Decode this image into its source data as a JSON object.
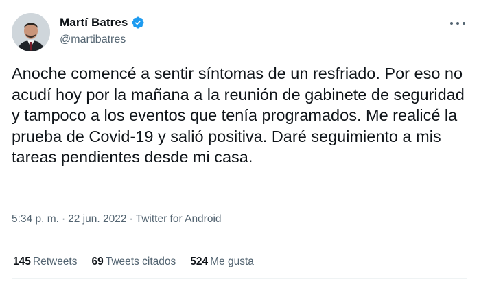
{
  "author": {
    "name": "Martí Batres",
    "handle": "@martibatres",
    "verified": true,
    "verified_color": "#1d9bf0"
  },
  "icons": {
    "more": "more-horizontal-icon",
    "verified": "verified-badge-icon"
  },
  "tweet": {
    "text": "Anoche comencé a sentir síntomas de un resfriado. Por eso no acudí hoy por la mañana a la reunión de gabinete de seguridad y tampoco a los eventos que tenía programados. Me realicé la prueba de Covid-19 y salió positiva. Daré seguimiento a mis tareas pendientes desde mi casa.",
    "time": "5:34 p. m.",
    "date": "22 jun. 2022",
    "source": "Twitter for Android",
    "separator": "·"
  },
  "stats": {
    "retweets": {
      "count": "145",
      "label": "Retweets"
    },
    "quotes": {
      "count": "69",
      "label": "Tweets citados"
    },
    "likes": {
      "count": "524",
      "label": "Me gusta"
    }
  },
  "colors": {
    "text": "#0f1419",
    "secondary": "#536471",
    "divider": "#eff3f4"
  }
}
